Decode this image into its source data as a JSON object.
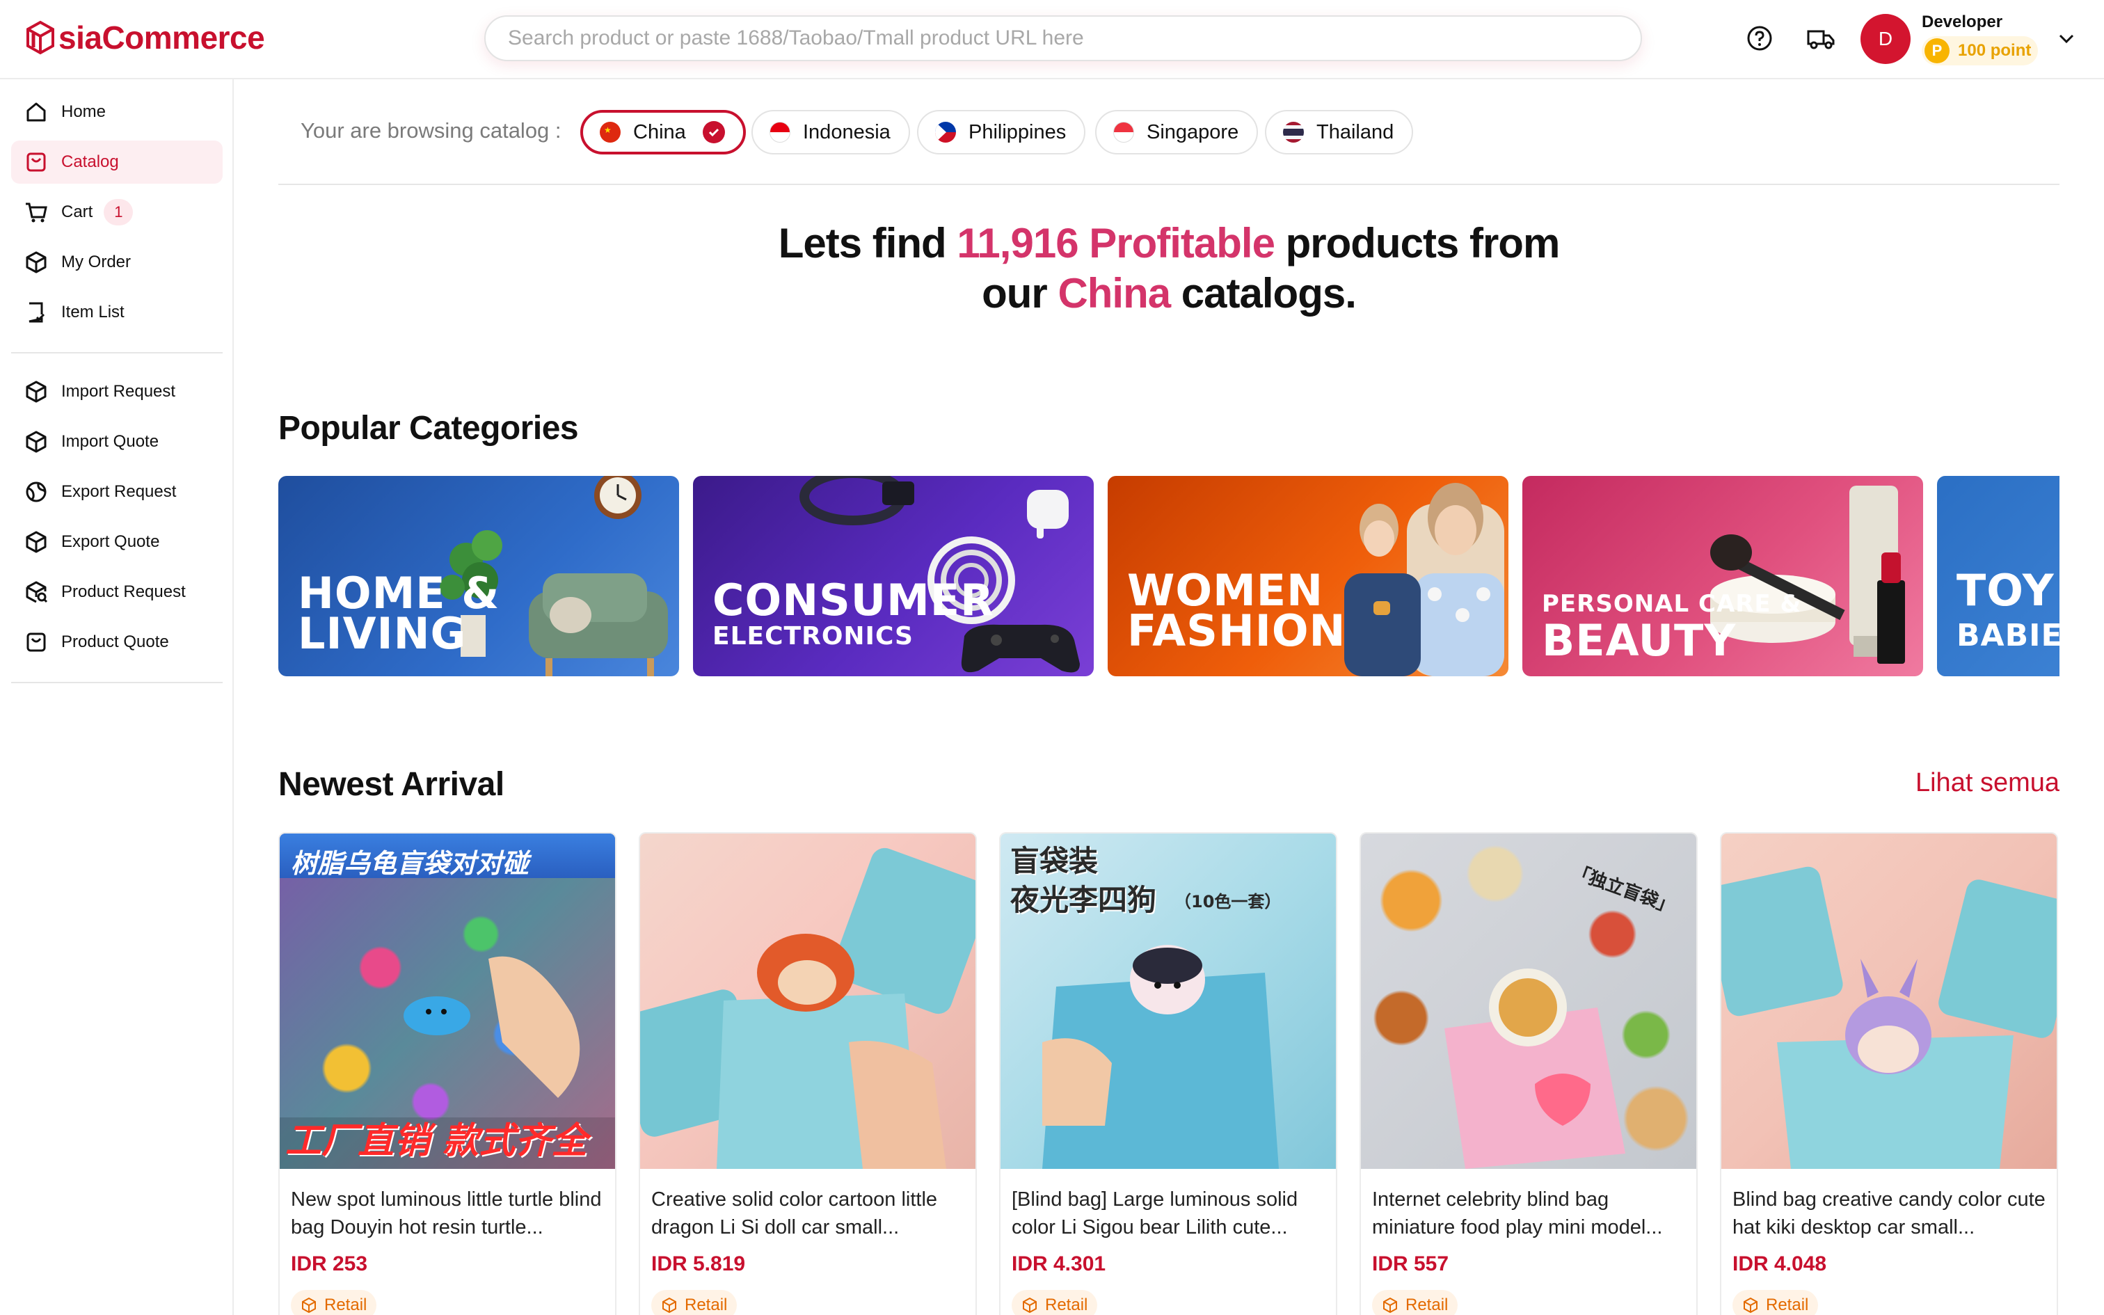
{
  "brand": {
    "name": "siaCommerce",
    "color": "#c8102e"
  },
  "search": {
    "placeholder": "Search product or paste 1688/Taobao/Tmall product URL here"
  },
  "header_icons": [
    "help-icon",
    "truck-icon"
  ],
  "user": {
    "initial": "D",
    "name": "Developer",
    "coin_letter": "P",
    "points": "100 point"
  },
  "sidebar": {
    "items": [
      {
        "label": "Home",
        "icon": "home-icon"
      },
      {
        "label": "Catalog",
        "icon": "catalog-icon",
        "active": true
      },
      {
        "label": "Cart",
        "icon": "cart-icon",
        "badge": "1"
      },
      {
        "label": "My Order",
        "icon": "box-icon"
      },
      {
        "label": "Item List",
        "icon": "list-icon"
      }
    ],
    "items2": [
      {
        "label": "Import Request",
        "icon": "box-icon"
      },
      {
        "label": "Import Quote",
        "icon": "box-icon"
      },
      {
        "label": "Export Request",
        "icon": "globe-icon"
      },
      {
        "label": "Export Quote",
        "icon": "box-icon"
      },
      {
        "label": "Product Request",
        "icon": "search-box-icon"
      },
      {
        "label": "Product Quote",
        "icon": "quote-icon"
      }
    ]
  },
  "catalog": {
    "label": "Your are browsing catalog :",
    "countries": [
      "China",
      "Indonesia",
      "Philippines",
      "Singapore",
      "Thailand"
    ],
    "selected": "China"
  },
  "hero": {
    "part1": "Lets find ",
    "count": "11,916 Profitable",
    "part2": " products from",
    "part3": "our ",
    "country": "China",
    "part4": " catalogs."
  },
  "popular": {
    "title": "Popular Categories",
    "cards": [
      {
        "line1": "HOME &",
        "line2": "LIVING"
      },
      {
        "line1": "CONSUMER",
        "line2": "ELECTRONICS"
      },
      {
        "line1": "WOMEN",
        "line2": "FASHION"
      },
      {
        "line1": "PERSONAL CARE &",
        "line2": "BEAUTY"
      },
      {
        "line1": "TOY",
        "line2": "BABIE"
      }
    ]
  },
  "newest": {
    "title": "Newest Arrival",
    "see_all": "Lihat semua",
    "products": [
      {
        "name": "New spot luminous little turtle blind bag Douyin hot resin turtle...",
        "price": "IDR 253",
        "tag": "Retail",
        "img_top": "树脂乌龟盲袋对对碰",
        "img_bottom": "工厂直销 款式齐全"
      },
      {
        "name": "Creative solid color cartoon little dragon Li Si doll car small...",
        "price": "IDR 5.819",
        "tag": "Retail"
      },
      {
        "name": "[Blind bag] Large luminous solid color Li Sigou bear Lilith cute...",
        "price": "IDR 4.301",
        "tag": "Retail",
        "img_top": "盲袋装",
        "img_mid": "夜光李四狗",
        "img_small": "（10色一套）"
      },
      {
        "name": "Internet celebrity blind bag miniature food play mini model...",
        "price": "IDR 557",
        "tag": "Retail",
        "img_top": "「独立盲袋」"
      },
      {
        "name": "Blind bag creative candy color cute hat kiki desktop car small...",
        "price": "IDR 4.048",
        "tag": "Retail"
      }
    ]
  }
}
